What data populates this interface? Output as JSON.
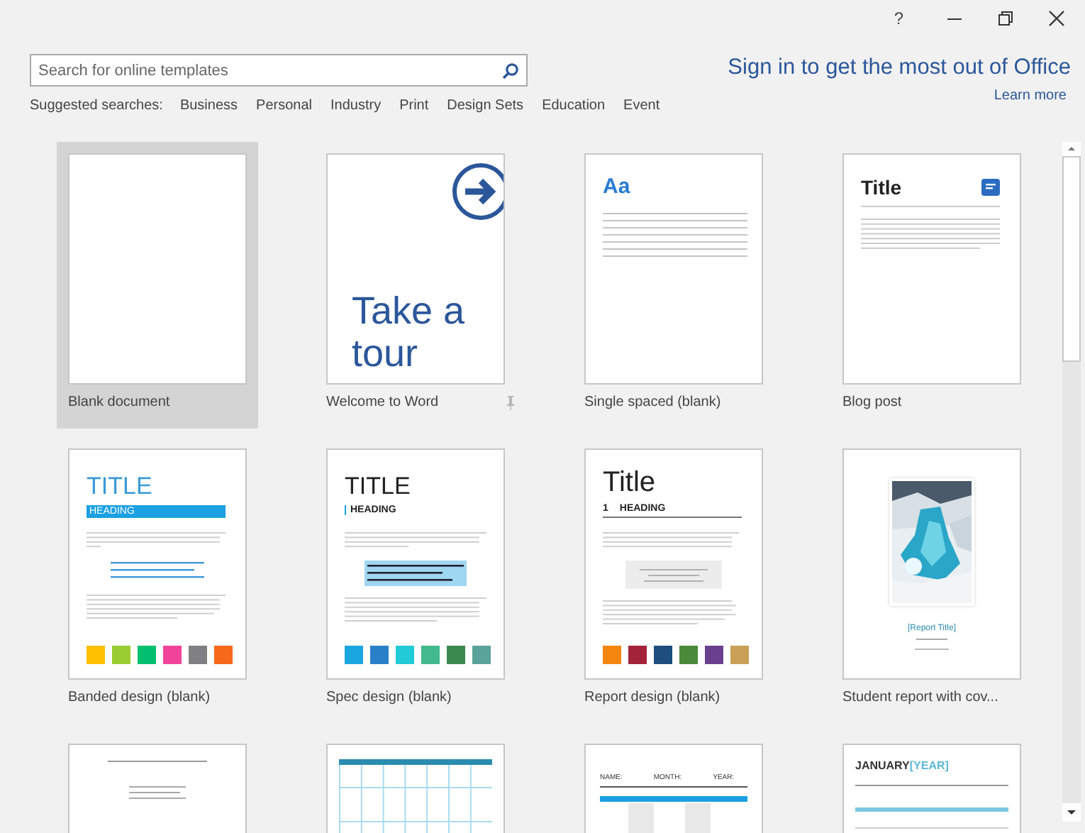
{
  "window": {
    "help": "?"
  },
  "search": {
    "placeholder": "Search for online templates"
  },
  "suggested": {
    "label": "Suggested searches:",
    "items": [
      "Business",
      "Personal",
      "Industry",
      "Print",
      "Design Sets",
      "Education",
      "Event"
    ]
  },
  "sign_in": {
    "text": "Sign in to get the most out of Office",
    "link": "Learn more"
  },
  "templates": [
    {
      "kind": "blank",
      "name": "Blank document",
      "selected": true,
      "pin": false
    },
    {
      "kind": "tour",
      "name": "Welcome to Word",
      "selected": false,
      "pin": true,
      "title": "Take a tour"
    },
    {
      "kind": "single",
      "name": "Single spaced (blank)",
      "selected": false,
      "pin": false,
      "title": "Aa"
    },
    {
      "kind": "blog",
      "name": "Blog post",
      "selected": false,
      "pin": false,
      "title": "Title"
    },
    {
      "kind": "banded",
      "name": "Banded design (blank)",
      "selected": false,
      "pin": false,
      "title": "TITLE",
      "heading": "HEADING",
      "swatches": [
        {
          "color": "#ffc000"
        },
        {
          "color": "#9acd32"
        },
        {
          "color": "#00c06f"
        },
        {
          "color": "#f0449a"
        },
        {
          "color": "#808084"
        },
        {
          "color": "#f7681b"
        }
      ]
    },
    {
      "kind": "spec",
      "name": "Spec design (blank)",
      "selected": false,
      "pin": false,
      "title": "TITLE",
      "heading": "HEADING",
      "swatches": [
        {
          "color": "#1aa7e0"
        },
        {
          "color": "#2a7fc9"
        },
        {
          "color": "#22c9d6"
        },
        {
          "color": "#43b98e"
        },
        {
          "color": "#3a8a4f"
        },
        {
          "color": "#5aa39a"
        }
      ]
    },
    {
      "kind": "report",
      "name": "Report design (blank)",
      "selected": false,
      "pin": false,
      "title": "Title",
      "number": "1",
      "heading": "HEADING",
      "swatches": [
        {
          "color": "#f5860f"
        },
        {
          "color": "#a3243a"
        },
        {
          "color": "#1d4e7e"
        },
        {
          "color": "#4a8a3a"
        },
        {
          "color": "#6a3f8f"
        },
        {
          "color": "#c9a055"
        }
      ]
    },
    {
      "kind": "cover",
      "name": "Student report with cov...",
      "selected": false,
      "pin": false,
      "title": "[Report Title]"
    },
    {
      "kind": "letter",
      "selected": false
    },
    {
      "kind": "calendar",
      "selected": false
    },
    {
      "kind": "schedule",
      "selected": false,
      "fields": [
        "NAME:",
        "MONTH:",
        "YEAR:"
      ]
    },
    {
      "kind": "month",
      "selected": false,
      "title": "JANUARY",
      "year": "[YEAR]"
    }
  ]
}
